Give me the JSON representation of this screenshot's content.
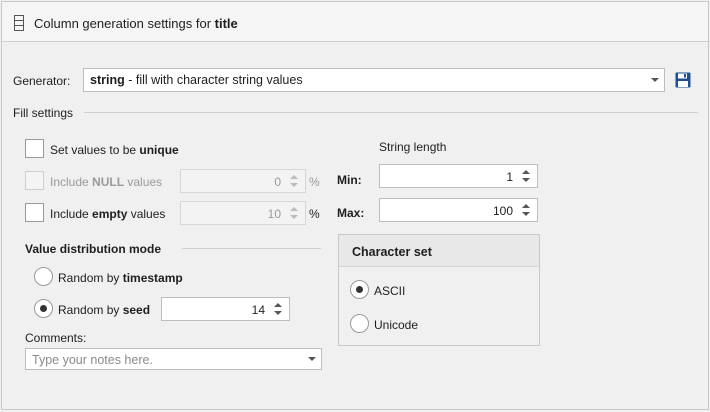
{
  "header": {
    "title_prefix": "Column generation settings for ",
    "title_column": "title",
    "icon": "column-icon"
  },
  "generator": {
    "label": "Generator:",
    "value_bold": "string",
    "value_rest": " - fill with character string values",
    "save_icon": "save-icon"
  },
  "fill_settings": {
    "label": "Fill settings"
  },
  "unique": {
    "label_prefix": "Set values to be ",
    "label_bold": "unique",
    "checked": false
  },
  "include_null": {
    "label_prefix": "Include ",
    "label_bold": "NULL",
    "label_suffix": " values",
    "value": "0",
    "unit": "%",
    "enabled": false
  },
  "include_empty": {
    "label_prefix": "Include ",
    "label_bold": "empty",
    "label_suffix": " values",
    "value": "10",
    "unit": "%",
    "checked": false
  },
  "distribution": {
    "title": "Value distribution mode",
    "timestamp_prefix": "Random by ",
    "timestamp_bold": "timestamp",
    "seed_prefix": "Random by ",
    "seed_bold": "seed",
    "seed_value": "14",
    "selected": "seed"
  },
  "comments": {
    "label": "Comments:",
    "placeholder": "Type your notes here."
  },
  "string_length": {
    "title": "String length",
    "min_label": "Min:",
    "min_value": "1",
    "max_label": "Max:",
    "max_value": "100"
  },
  "charset": {
    "title": "Character set",
    "ascii": "ASCII",
    "unicode": "Unicode",
    "selected": "ASCII"
  },
  "colors": {
    "save_icon": "#1e4f8f",
    "border": "#bdbdbd"
  }
}
